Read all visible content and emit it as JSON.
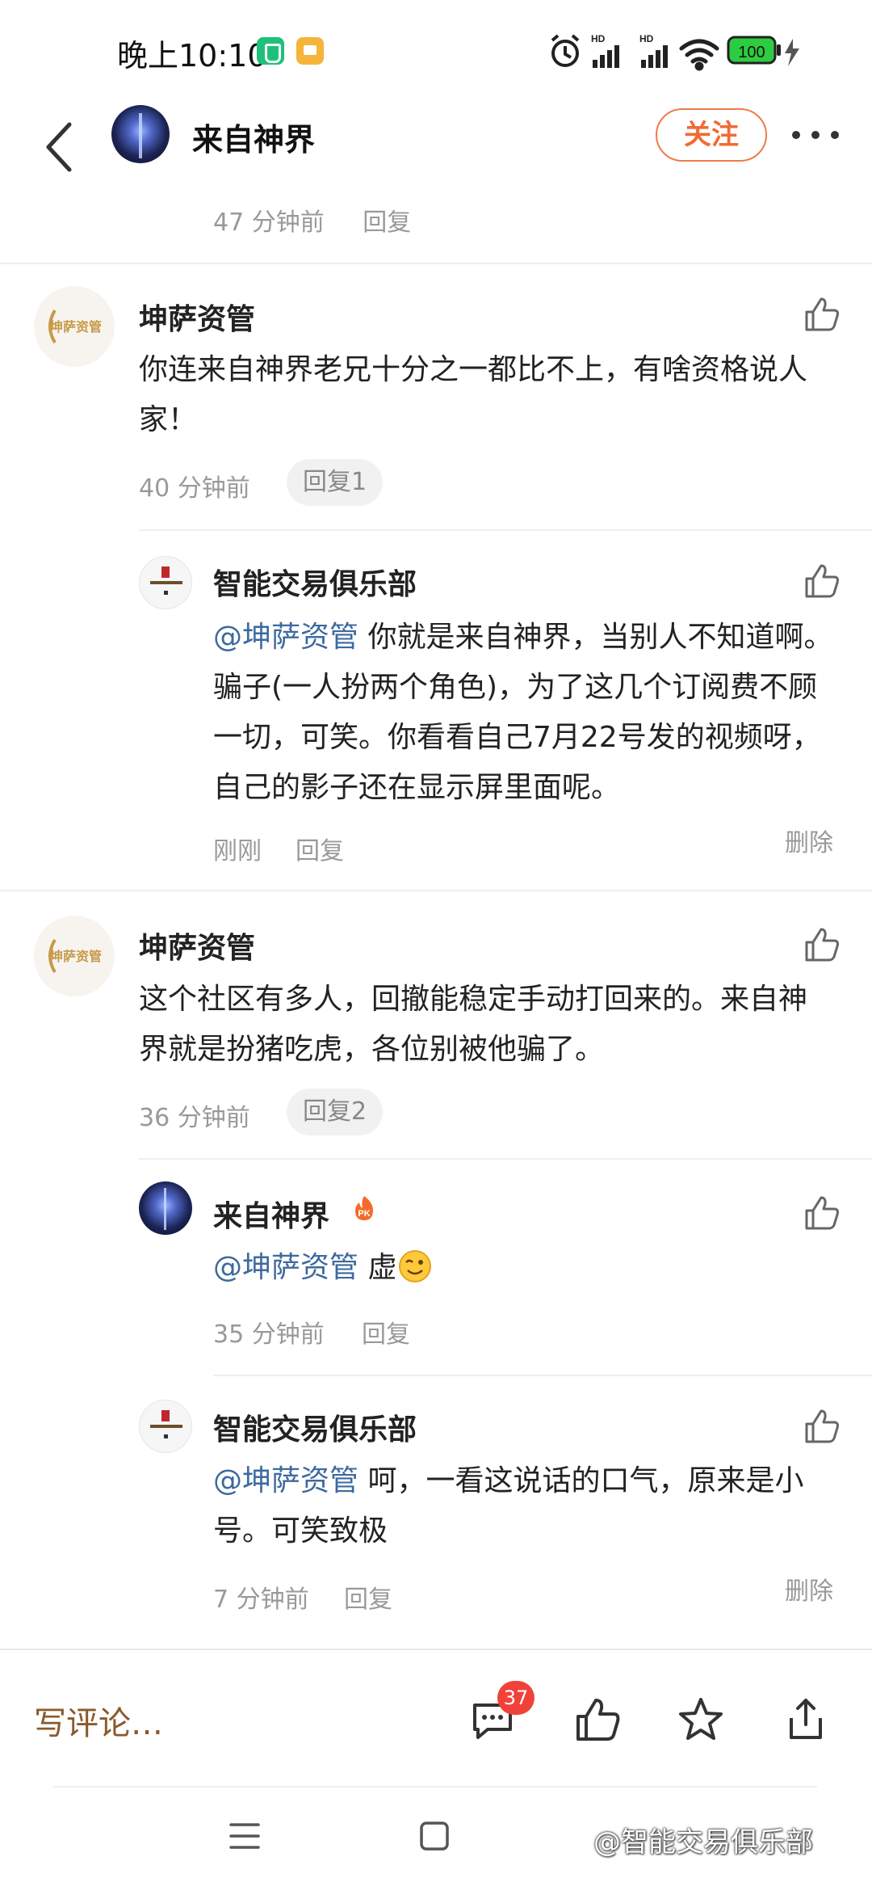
{
  "status_bar": {
    "time": "晚上10:10",
    "battery": "100"
  },
  "header": {
    "title": "来自神界",
    "follow_label": "关注"
  },
  "top_meta": {
    "time": "47 分钟前",
    "reply_label": "回复"
  },
  "comments": [
    {
      "author": "坤萨资管",
      "text": "你连来自神界老兄十分之一都比不上，有啥资格说人家！",
      "time": "40 分钟前",
      "reply_pill": "回复1",
      "replies": [
        {
          "author": "智能交易俱乐部",
          "mention": "@坤萨资管",
          "text": " 你就是来自神界，当别人不知道啊。骗子(一人扮两个角色)，为了这几个订阅费不顾一切，可笑。你看看自己7月22号发的视频呀，自己的影子还在显示屏里面呢。",
          "time": "刚刚",
          "reply_label": "回复",
          "delete_label": "删除"
        }
      ]
    },
    {
      "author": "坤萨资管",
      "text": "这个社区有多人，回撤能稳定手动打回来的。来自神界就是扮猪吃虎，各位别被他骗了。",
      "time": "36 分钟前",
      "reply_pill": "回复2",
      "replies": [
        {
          "author": "来自神界",
          "mention": "@坤萨资管",
          "text": " 虚",
          "time": "35 分钟前",
          "reply_label": "回复"
        },
        {
          "author": "智能交易俱乐部",
          "mention": "@坤萨资管",
          "text": " 呵，一看这说话的口气，原来是小号。可笑致极",
          "time": "7 分钟前",
          "reply_label": "回复",
          "delete_label": "删除"
        }
      ]
    }
  ],
  "bottom_bar": {
    "write_placeholder": "写评论…",
    "comment_count": "37"
  },
  "watermark": "@智能交易俱乐部",
  "colors": {
    "accent": "#f06a35",
    "mention": "#3d6a9e",
    "meta": "#999999",
    "badge": "#f0423a"
  }
}
